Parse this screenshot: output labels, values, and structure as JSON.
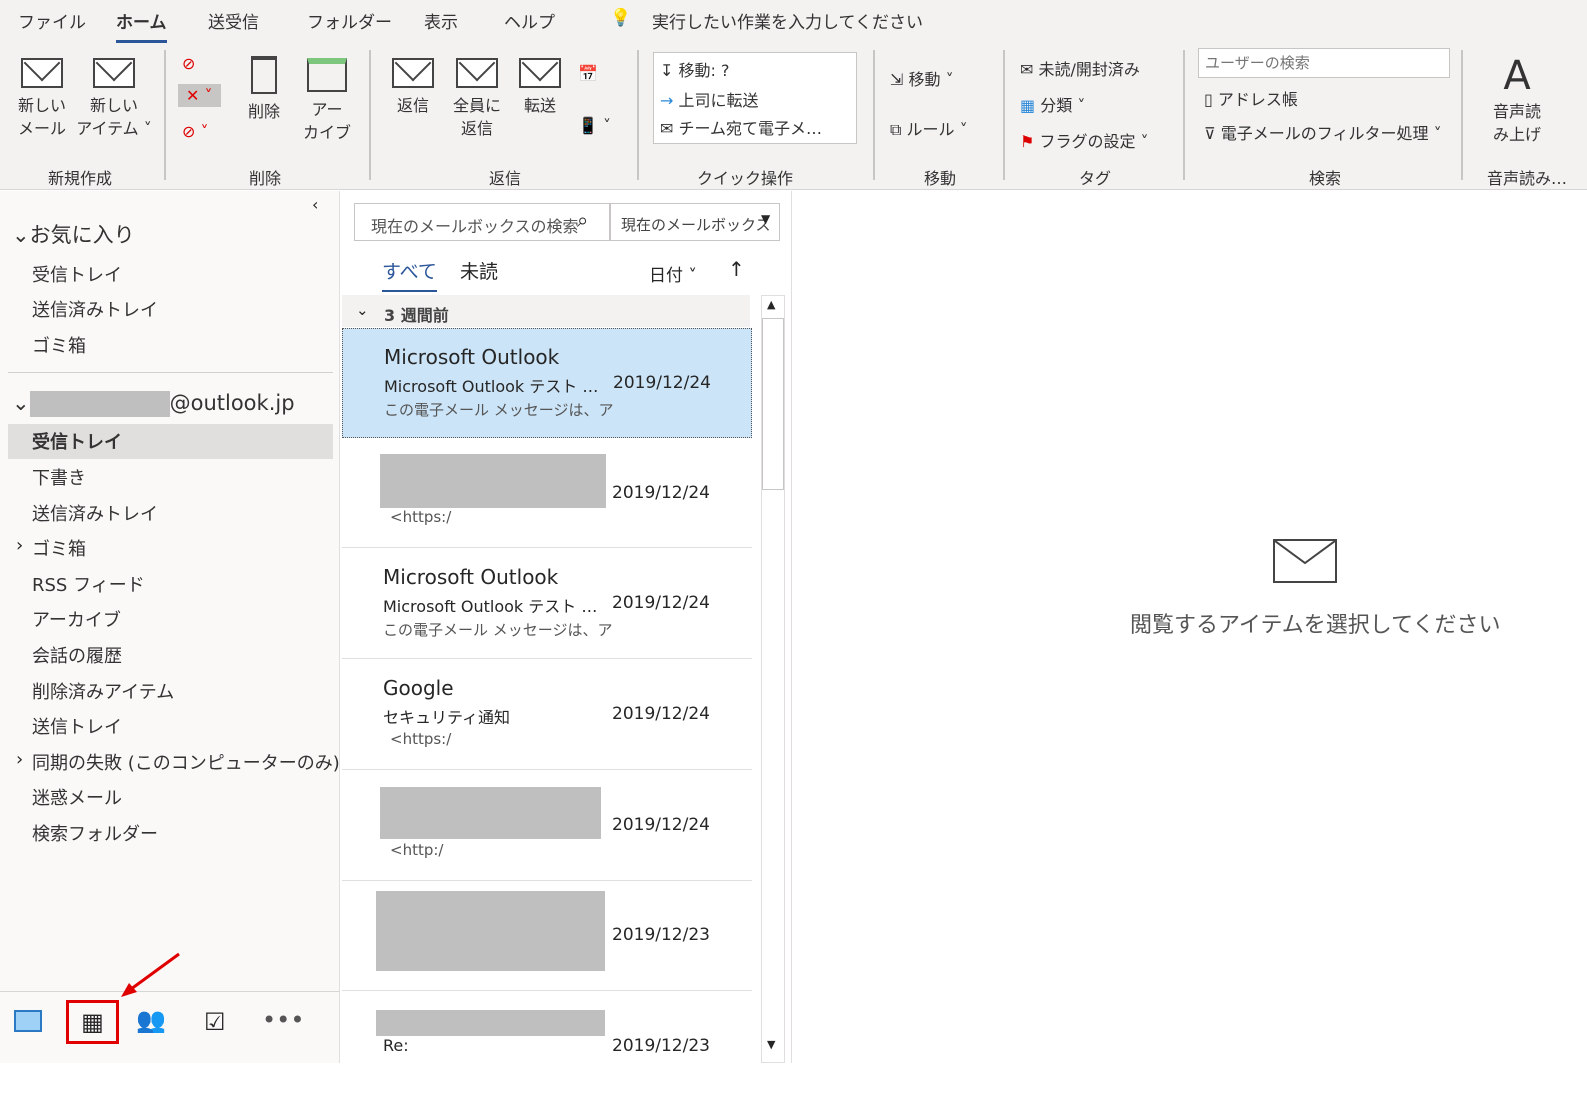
{
  "menu_tabs": [
    "ファイル",
    "ホーム",
    "送受信",
    "フォルダー",
    "表示",
    "ヘルプ"
  ],
  "tell_me": "実行したい作業を入力してください",
  "ribbon": {
    "new": {
      "new_mail": [
        "新しい",
        "メール"
      ],
      "new_item": [
        "新しい",
        "アイテム"
      ],
      "group": "新規作成"
    },
    "delete": {
      "delete": "削除",
      "archive": [
        "アー",
        "カイブ"
      ],
      "group": "削除"
    },
    "respond": {
      "reply": "返信",
      "reply_all": [
        "全員に",
        "返信"
      ],
      "forward": "転送",
      "group": "返信"
    },
    "quick": {
      "items": [
        "移動: ?",
        "上司に転送",
        "チーム宛て電子メ…"
      ],
      "group": "クイック操作"
    },
    "move": {
      "move": "移動",
      "rules": "ルール",
      "group": "移動"
    },
    "tags": {
      "unread": "未読/開封済み",
      "categorize": "分類",
      "flag": "フラグの設定",
      "group": "タグ"
    },
    "find": {
      "search_placeholder": "ユーザーの検索",
      "address_book": "アドレス帳",
      "filter": "電子メールのフィルター処理",
      "group": "検索"
    },
    "speech": {
      "read_aloud": [
        "音声読",
        "み上げ"
      ],
      "group": "音声読み…"
    }
  },
  "nav": {
    "favorites_header": "お気に入り",
    "favorites": [
      "受信トレイ",
      "送信済みトレイ",
      "ゴミ箱"
    ],
    "account_suffix": "@outlook.jp",
    "folders": [
      "受信トレイ",
      "下書き",
      "送信済みトレイ",
      "ゴミ箱",
      "RSS フィード",
      "アーカイブ",
      "会話の履歴",
      "削除済みアイテム",
      "送信トレイ",
      "同期の失敗 (このコンピューターのみ)",
      "迷惑メール",
      "検索フォルダー"
    ]
  },
  "list": {
    "search_placeholder": "現在のメールボックスの検索",
    "scope": "現在のメールボックス",
    "tab_all": "すべて",
    "tab_unread": "未読",
    "sort": "日付",
    "group_header": "3 週間前",
    "messages": [
      {
        "sender": "Microsoft Outlook",
        "subject": "Microsoft Outlook テスト メッセージ",
        "date": "2019/12/24",
        "preview": "この電子メール メッセージは、ア"
      },
      {
        "sender": "",
        "subject": "",
        "date": "2019/12/24",
        "preview": "<https:/"
      },
      {
        "sender": "Microsoft Outlook",
        "subject": "Microsoft Outlook テスト メッセージ",
        "date": "2019/12/24",
        "preview": "この電子メール メッセージは、ア"
      },
      {
        "sender": "Google",
        "subject": "セキュリティ通知",
        "date": "2019/12/24",
        "preview": "<https:/"
      },
      {
        "sender": "",
        "subject": "",
        "date": "2019/12/24",
        "preview": "<http:/"
      },
      {
        "sender": "",
        "subject": "",
        "date": "2019/12/23",
        "preview": ""
      },
      {
        "sender": "",
        "subject": "Re:",
        "date": "2019/12/23",
        "preview": ""
      }
    ]
  },
  "reading": {
    "empty_text": "閲覧するアイテムを選択してください"
  },
  "colors": {
    "accent": "#2b579a",
    "selected": "#cce4f7",
    "highlight": "#e00000"
  }
}
